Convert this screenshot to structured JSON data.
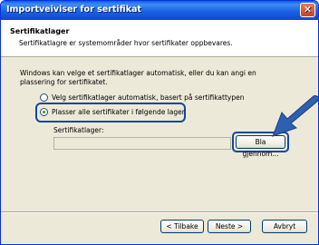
{
  "window": {
    "title": "Importveiviser for sertifikat",
    "close_glyph": "✕"
  },
  "header": {
    "title": "Sertifikatlager",
    "description": "Sertifikatlagre er systemområder hvor sertifikater oppbevares."
  },
  "body": {
    "intro": "Windows kan velge et sertifikatlager automatisk, eller du kan angi en plassering for sertifikatet.",
    "options": [
      {
        "label": "Velg sertifikatlager automatisk, basert på sertifikattypen",
        "checked": false
      },
      {
        "label": "Plasser alle sertifikater i følgende lager",
        "checked": true
      }
    ],
    "store_label": "Sertifikatlager:",
    "store_value": "",
    "browse_label": "Bla gjennom..."
  },
  "footer": {
    "back_label": "< Tilbake",
    "next_label": "Neste >",
    "cancel_label": "Avbryt"
  },
  "colors": {
    "titlebar": "#0a5ee8",
    "highlight": "#17479c",
    "arrow": "#2f5fb0"
  },
  "icons": {
    "close": "close-icon",
    "arrow": "pointer-arrow-icon"
  }
}
